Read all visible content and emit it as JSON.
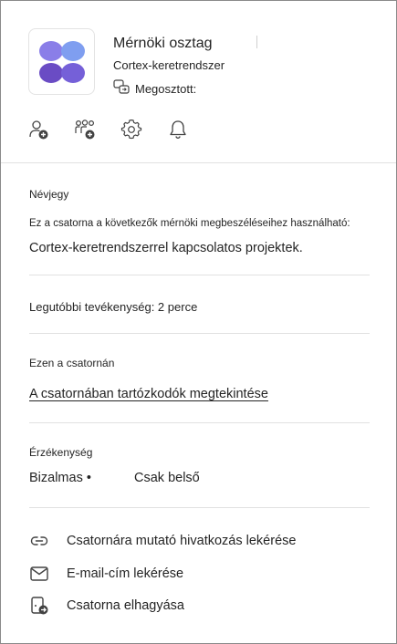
{
  "team": {
    "name": "Mérnöki osztag",
    "subtitle": "Cortex-keretrendszer",
    "shared_label": "Megosztott:",
    "logo_colors": {
      "light": "#7f9ef0",
      "mid": "#8a7ee8",
      "dark": "#6a4cc4"
    }
  },
  "actions": [
    {
      "name": "add-member",
      "icon": "person-add-icon"
    },
    {
      "name": "add-team",
      "icon": "people-add-icon"
    },
    {
      "name": "settings",
      "icon": "gear-icon"
    },
    {
      "name": "notifications",
      "icon": "bell-icon"
    }
  ],
  "about": {
    "title": "Névjegy",
    "description_line1": "Ez a csatorna a következők mérnöki megbeszéléseihez használható:",
    "description_line2": "Cortex-keretrendszerrel kapcsolatos projektek."
  },
  "activity": {
    "text": "Legutóbbi tevékenység: 2 perce"
  },
  "channel": {
    "title": "Ezen a csatornán",
    "members_link": "A csatornában tartózkodók megtekintése"
  },
  "sensitivity": {
    "title": "Érzékenység",
    "label": "Bizalmas •",
    "scope": "Csak belső"
  },
  "menu": [
    {
      "label": "Csatornára mutató hivatkozás lekérése",
      "icon": "link-icon"
    },
    {
      "label": "E-mail-cím lekérése",
      "icon": "mail-icon"
    },
    {
      "label": "Csatorna elhagyása",
      "icon": "leave-icon"
    }
  ],
  "colors": {
    "text": "#242424",
    "divider": "#e1e1e1",
    "icon": "#424242"
  }
}
